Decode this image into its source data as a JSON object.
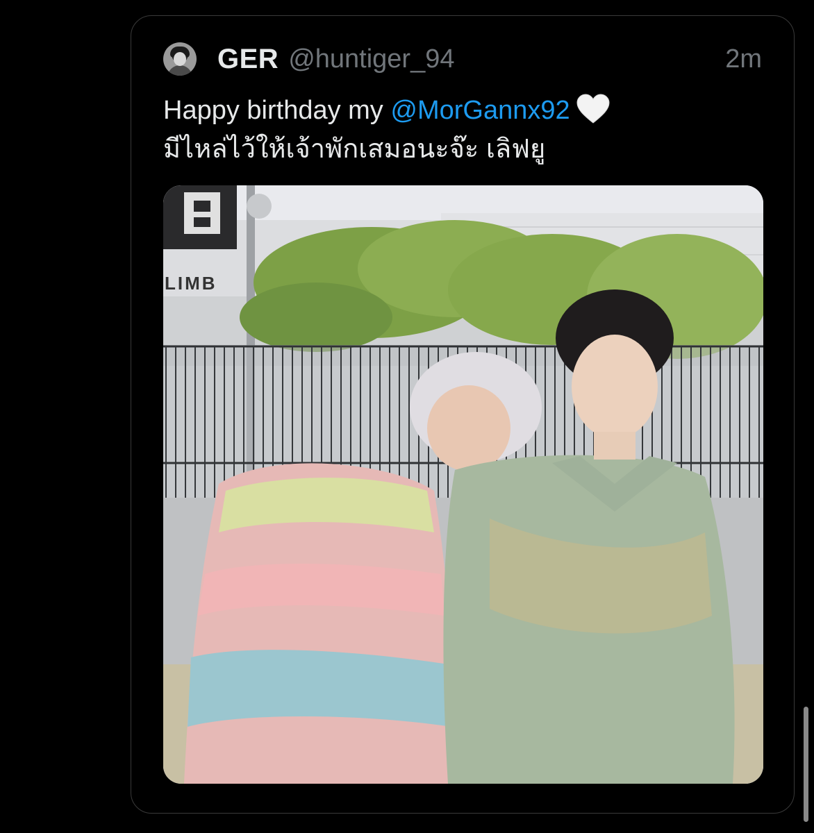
{
  "tweet": {
    "display_name": "GER",
    "handle": "@huntiger_94",
    "timestamp": "2m",
    "text_line1_prefix": "Happy birthday my ",
    "mention": "@MorGannx92",
    "text_line2": "มีไหล่ไว้ให้เจ้าพักเสมอนะจ๊ะ เลิฟยู",
    "heart_icon": "white-heart-icon",
    "avatar_icon": "profile-avatar"
  },
  "media": {
    "sign_text": "LIMB",
    "sign_logo": "B"
  },
  "colors": {
    "background": "#000000",
    "text": "#e7e9ea",
    "secondary": "#71767b",
    "link": "#1d9bf0",
    "border": "#3a3a3a"
  }
}
